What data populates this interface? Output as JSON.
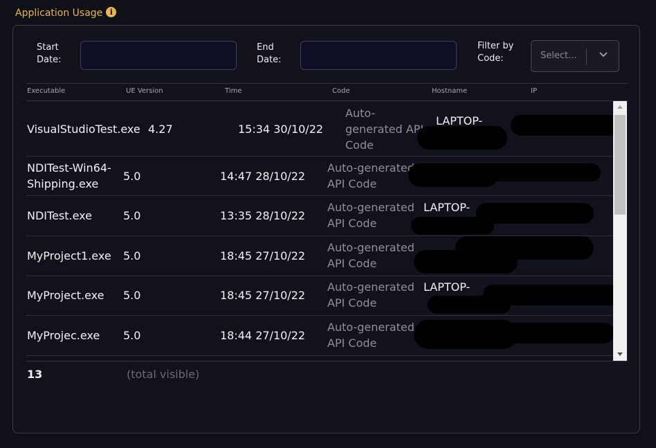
{
  "section": {
    "title": "Application Usage",
    "info_icon": "info-circle-icon"
  },
  "filters": {
    "start_date_label": [
      "Start",
      "Date:"
    ],
    "start_date_value": "",
    "end_date_label": [
      "End",
      "Date:"
    ],
    "end_date_value": "",
    "code_label": [
      "Filter by",
      "Code:"
    ],
    "code_placeholder": "Select..."
  },
  "table": {
    "columns": [
      "Executable",
      "UE Version",
      "Time",
      "Code",
      "Hostname",
      "IP"
    ],
    "rows": [
      {
        "executable": [
          "VisualStudioTest.exe"
        ],
        "ue_version": "4.27",
        "time": "15:34 30/10/22",
        "code": [
          "Auto-",
          "generated API",
          "Code"
        ],
        "hostname": "LAPTOP-"
      },
      {
        "executable": [
          "NDITest-Win64-",
          "Shipping.exe"
        ],
        "ue_version": "5.0",
        "time": "14:47 28/10/22",
        "code": [
          "Auto-generated",
          "API Code"
        ],
        "hostname": ""
      },
      {
        "executable": [
          "NDITest.exe"
        ],
        "ue_version": "5.0",
        "time": "13:35 28/10/22",
        "code": [
          "Auto-generated",
          "API Code"
        ],
        "hostname": "LAPTOP-"
      },
      {
        "executable": [
          "MyProject1.exe"
        ],
        "ue_version": "5.0",
        "time": "18:45 27/10/22",
        "code": [
          "Auto-generated",
          "API Code"
        ],
        "hostname": ""
      },
      {
        "executable": [
          "MyProject.exe"
        ],
        "ue_version": "5.0",
        "time": "18:45 27/10/22",
        "code": [
          "Auto-generated",
          "API Code"
        ],
        "hostname": "LAPTOP-"
      },
      {
        "executable": [
          "MyProjec.exe"
        ],
        "ue_version": "5.0",
        "time": "18:44 27/10/22",
        "code": [
          "Auto-generated",
          "API Code"
        ],
        "hostname": ""
      }
    ]
  },
  "footer": {
    "count": "13",
    "label": "(total visible)"
  },
  "colors": {
    "accent": "#e7b64a",
    "background": "#101019",
    "panel_border": "#3a3a46",
    "input_bg": "#0e0e24"
  }
}
